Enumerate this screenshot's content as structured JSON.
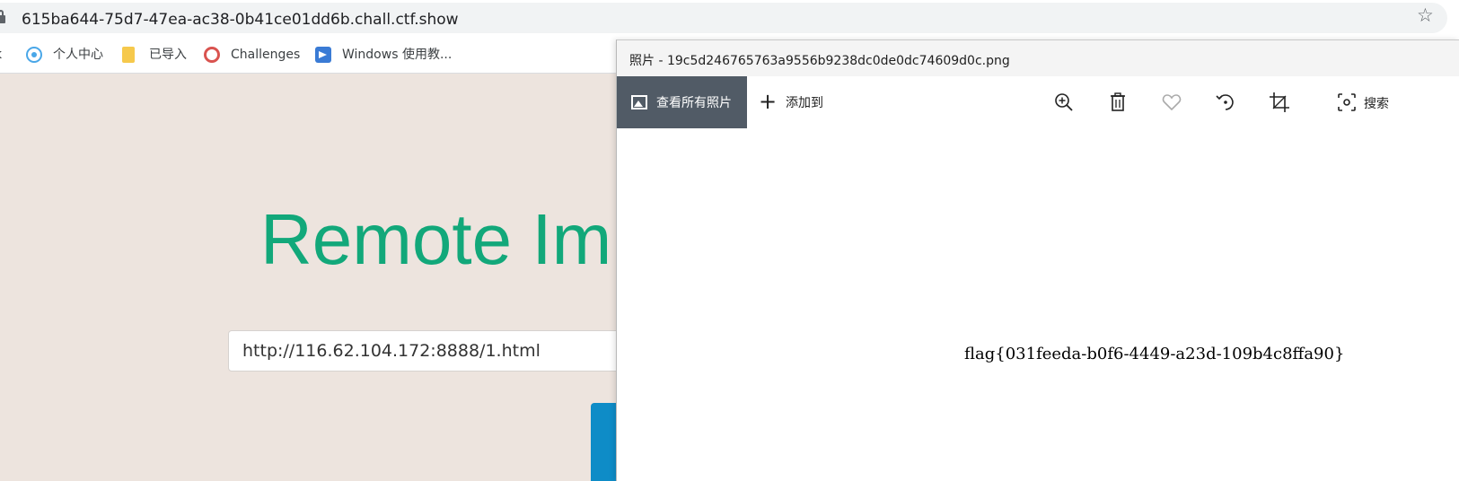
{
  "browser": {
    "url": "615ba644-75d7-47ea-ac38-0b41ce01dd6b.chall.ctf.show",
    "bookmarks": [
      {
        "label": "k",
        "icon": "bookmark-icon"
      },
      {
        "label": "个人中心",
        "icon": "globe-icon"
      },
      {
        "label": "已导入",
        "icon": "folder-icon"
      },
      {
        "label": "Challenges",
        "icon": "ctf-logo-icon"
      },
      {
        "label": "Windows 使用教...",
        "icon": "paper-plane-icon"
      }
    ]
  },
  "page": {
    "heading": "Remote Im",
    "url_input_value": "http://116.62.104.172:8888/1.html",
    "accent_color": "#12a87a",
    "button_color": "#0e8cc7"
  },
  "photos_app": {
    "title": "照片 - 19c5d246765763a9556b9238dc0de0dc74609d0c.png",
    "toolbar": {
      "view_all": "查看所有照片",
      "add_to": "添加到",
      "search": "搜索",
      "icons": [
        "zoom-in-icon",
        "delete-icon",
        "favorite-icon",
        "rotate-icon",
        "crop-icon",
        "search-icon"
      ]
    },
    "image_text": "flag{031feeda-b0f6-4449-a23d-109b4c8ffa90}"
  }
}
